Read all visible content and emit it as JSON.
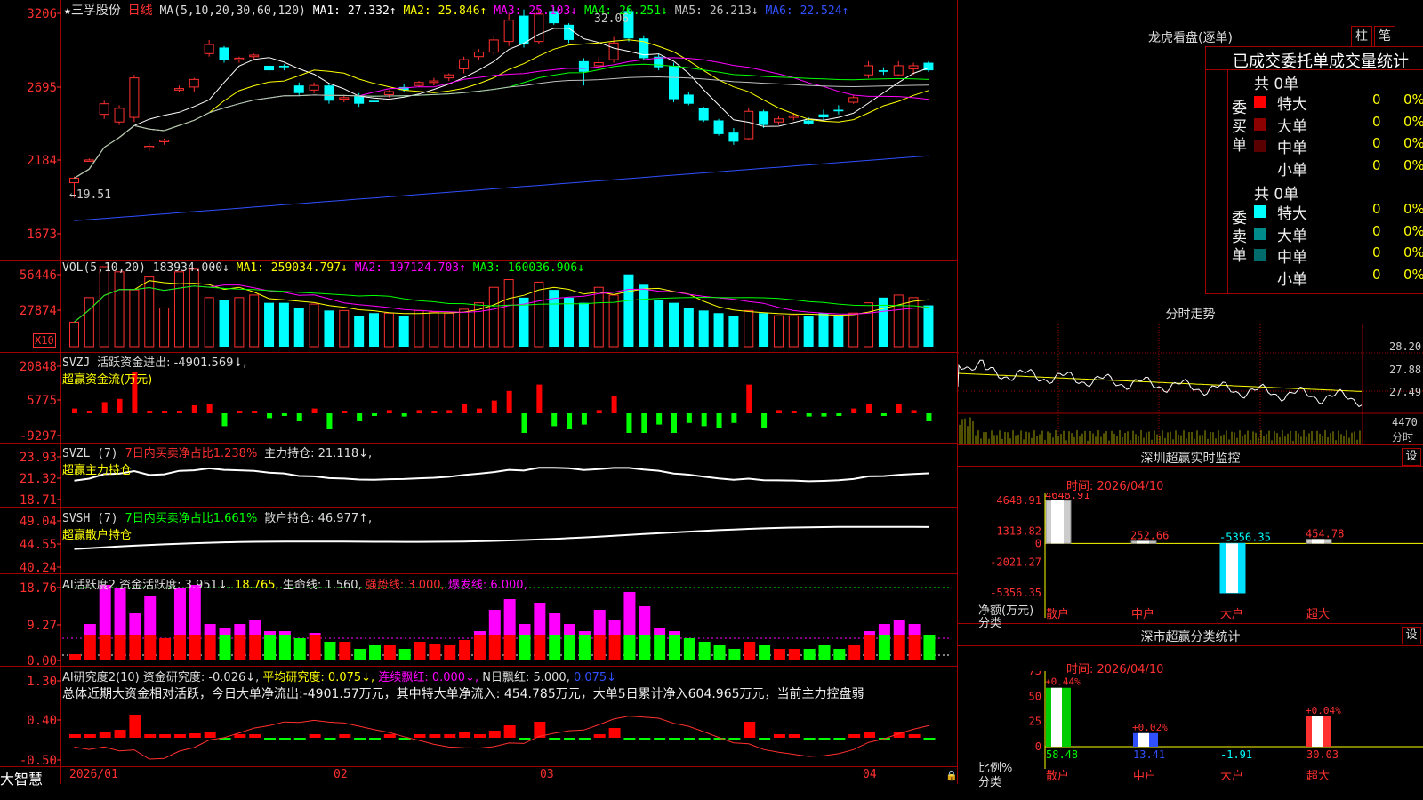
{
  "stock": {
    "name": "三孚股份",
    "period": "日线",
    "star": "★"
  },
  "ma_legend": {
    "label": "MA(5,10,20,30,60,120)",
    "items": [
      {
        "text": "MA1: 27.332↑",
        "color": "#ffffff"
      },
      {
        "text": "MA2: 25.846↑",
        "color": "#ffff00"
      },
      {
        "text": "MA3: 25.103↓",
        "color": "#ff00ff"
      },
      {
        "text": "MA4: 26.251↓",
        "color": "#00ff00"
      },
      {
        "text": "MA5: 26.213↓",
        "color": "#c0c0c0"
      },
      {
        "text": "MA6: 22.524↑",
        "color": "#3050ff"
      }
    ],
    "high_label": "32.06",
    "low_label": "←19.51"
  },
  "price_axis": [
    "3206",
    "2695",
    "2184",
    "1673"
  ],
  "vol": {
    "label": "VOL(5,10,20)",
    "value": "183934.000↓",
    "items": [
      {
        "text": "MA1: 259034.797↓",
        "color": "#ffff00"
      },
      {
        "text": "MA2: 197124.703↑",
        "color": "#ff00ff"
      },
      {
        "text": "MA3: 160036.906↓",
        "color": "#00ff00"
      }
    ],
    "axis": [
      "56446",
      "27874"
    ],
    "unit": "X10"
  },
  "svzj": {
    "label": "SVZJ",
    "line1": "活跃资金进出: -4901.569↓,",
    "line2": "超赢资金流(万元)",
    "axis": [
      "20848",
      "5775",
      "-9297"
    ]
  },
  "svzl": {
    "label": "SVZL (7)",
    "pct": "7日内买卖净占比1.238%",
    "hold": "主力持仓: 21.118↓,",
    "line2": "超赢主力持仓",
    "axis": [
      "23.93",
      "21.32",
      "18.71"
    ]
  },
  "svsh": {
    "label": "SVSH (7)",
    "pct": "7日内买卖净占比1.661%",
    "hold": "散户持仓: 46.977↑,",
    "line2": "超赢散户持仓",
    "axis": [
      "49.04",
      "44.55",
      "40.24"
    ]
  },
  "ai1": {
    "label": "AI活跃度2",
    "v1": "资金活跃度: 3.951↓,",
    "v2": "18.765,",
    "v3": "生命线: 1.560,",
    "v4": "强势线: 3.000,",
    "v5": "爆发线: 6.000,",
    "axis": [
      "18.76",
      "9.27",
      "0.00"
    ]
  },
  "ai2": {
    "label": "AI研究度2(10)",
    "v1": "资金研究度: -0.026↓,",
    "v2": "平均研究度: 0.075↓,",
    "v3": "连续飘红: 0.000↓,",
    "v4": "N日飘红: 5.000,",
    "v5": "0.075↓",
    "axis": [
      "1.30",
      "0.40",
      "-0.50"
    ],
    "summary": "总体近期大资金相对活跃，今日大单净流出:-4901.57万元，其中特大单净流入: 454.785万元，大单5日累计净入604.965万元，当前主力控盘弱"
  },
  "date_axis": [
    "2026/01",
    "02",
    "03",
    "04"
  ],
  "brand": "大智慧",
  "lhb": {
    "title": "龙虎看盘(逐单)",
    "btn1": "柱",
    "btn2": "笔",
    "subtitle": "已成交委托单成交量统计",
    "buy": {
      "side": "委买单",
      "total": "共 0单",
      "rows": [
        {
          "name": "特大",
          "n": "0",
          "p": "0%",
          "color": "#ff0000"
        },
        {
          "name": "大单",
          "n": "0",
          "p": "0%",
          "color": "#8b0000"
        },
        {
          "name": "中单",
          "n": "0",
          "p": "0%",
          "color": "#5a0000"
        },
        {
          "name": "小单",
          "n": "0",
          "p": "0%",
          "color": "#000000"
        }
      ]
    },
    "sell": {
      "side": "委卖单",
      "total": "共 0单",
      "rows": [
        {
          "name": "特大",
          "n": "0",
          "p": "0%",
          "color": "#00ffff"
        },
        {
          "name": "大单",
          "n": "0",
          "p": "0%",
          "color": "#008b8b"
        },
        {
          "name": "中单",
          "n": "0",
          "p": "0%",
          "color": "#006b6b"
        },
        {
          "name": "小单",
          "n": "0",
          "p": "0%",
          "color": "#000000"
        }
      ]
    }
  },
  "fenshi": {
    "title": "分时走势",
    "axis": [
      "28.20",
      "27.88",
      "27.49"
    ],
    "vol_label": "4470",
    "vol_unit": "分时"
  },
  "sz_monitor": {
    "title": "深圳超赢实时监控",
    "btn": "设",
    "date": "时间: 2026/04/10",
    "axis": [
      "4648.91",
      "1313.82",
      "0",
      "-2021.27",
      "-5356.35"
    ],
    "bars": [
      {
        "cat": "散户",
        "value": 4648.91,
        "label": "4648.91"
      },
      {
        "cat": "中户",
        "value": 252.66,
        "label": "252.66"
      },
      {
        "cat": "大户",
        "value": -5356.35,
        "label": "-5356.35"
      },
      {
        "cat": "超大",
        "value": 454.78,
        "label": "454.78"
      }
    ],
    "ylabel": "净额(万元)",
    "xlabel": "分类"
  },
  "sz_class": {
    "title": "深市超赢分类统计",
    "btn": "设",
    "date": "时间: 2026/04/10",
    "axis": [
      "75",
      "50",
      "25",
      "0"
    ],
    "bars": [
      {
        "cat": "散户",
        "value": 58.48,
        "top": "+0.44%",
        "bottom": "58.48"
      },
      {
        "cat": "中户",
        "value": 13.41,
        "top": "+0.02%",
        "bottom": "13.41"
      },
      {
        "cat": "大户",
        "value": -1.91,
        "top": "",
        "bottom": "-1.91"
      },
      {
        "cat": "超大",
        "value": 30.03,
        "top": "+0.04%",
        "bottom": "30.03"
      }
    ],
    "ylabel": "比例%",
    "xlabel": "分类"
  },
  "chart_data": {
    "type": "candlestick",
    "title": "三孚股份 日线",
    "ylim": [
      16.73,
      32.06
    ],
    "series": [
      {
        "name": "OHLC",
        "values": [
          [
            20.5,
            20.9,
            19.51,
            20.8
          ],
          [
            22.0,
            22.1,
            21.9,
            22.0
          ],
          [
            25.0,
            25.9,
            24.7,
            25.7
          ],
          [
            24.5,
            25.6,
            24.3,
            25.4
          ],
          [
            24.8,
            27.6,
            24.5,
            27.4
          ],
          [
            22.8,
            23.1,
            22.6,
            22.9
          ],
          [
            23.2,
            23.4,
            23.0,
            23.3
          ],
          [
            26.6,
            26.9,
            26.5,
            26.7
          ],
          [
            26.8,
            27.4,
            26.5,
            27.3
          ],
          [
            29.0,
            29.9,
            28.8,
            29.6
          ],
          [
            29.4,
            29.5,
            28.4,
            28.6
          ],
          [
            28.6,
            28.8,
            28.4,
            28.7
          ],
          [
            28.8,
            29.0,
            28.6,
            28.9
          ],
          [
            28.2,
            28.5,
            27.6,
            27.9
          ],
          [
            28.2,
            28.3,
            27.9,
            28.1
          ],
          [
            26.9,
            27.1,
            26.2,
            26.4
          ],
          [
            26.6,
            27.1,
            26.4,
            26.9
          ],
          [
            26.9,
            27.0,
            25.7,
            25.9
          ],
          [
            26.0,
            26.3,
            25.8,
            26.1
          ],
          [
            26.2,
            26.4,
            25.5,
            25.7
          ],
          [
            25.9,
            26.3,
            25.6,
            25.8
          ],
          [
            26.3,
            26.6,
            26.1,
            26.5
          ],
          [
            26.8,
            27.0,
            26.5,
            26.6
          ],
          [
            26.9,
            27.2,
            26.8,
            27.1
          ],
          [
            27.1,
            27.4,
            26.9,
            27.2
          ],
          [
            27.4,
            27.7,
            27.2,
            27.6
          ],
          [
            28.0,
            28.8,
            27.7,
            28.6
          ],
          [
            28.8,
            29.3,
            28.6,
            29.1
          ],
          [
            29.1,
            30.2,
            28.9,
            29.9
          ],
          [
            29.8,
            31.6,
            29.5,
            31.2
          ],
          [
            31.5,
            31.9,
            29.4,
            29.6
          ],
          [
            29.8,
            31.9,
            29.6,
            31.6
          ],
          [
            31.8,
            32.06,
            30.9,
            31.0
          ],
          [
            30.9,
            31.0,
            29.7,
            29.9
          ],
          [
            28.5,
            28.7,
            26.9,
            27.8
          ],
          [
            28.2,
            28.8,
            27.9,
            28.4
          ],
          [
            28.6,
            30.1,
            28.4,
            29.7
          ],
          [
            31.8,
            32.0,
            29.8,
            30.0
          ],
          [
            30.0,
            30.2,
            28.6,
            28.7
          ],
          [
            28.8,
            29.0,
            27.9,
            28.1
          ],
          [
            28.2,
            28.4,
            25.8,
            26.0
          ],
          [
            26.3,
            26.5,
            25.6,
            25.7
          ],
          [
            25.4,
            25.5,
            24.5,
            24.6
          ],
          [
            24.6,
            24.7,
            23.6,
            23.7
          ],
          [
            23.8,
            24.1,
            23.0,
            23.2
          ],
          [
            23.4,
            25.4,
            23.3,
            25.2
          ],
          [
            25.2,
            25.3,
            24.1,
            24.3
          ],
          [
            24.5,
            24.9,
            24.3,
            24.7
          ],
          [
            24.8,
            25.1,
            24.6,
            24.9
          ],
          [
            24.6,
            24.8,
            24.3,
            24.4
          ],
          [
            25.0,
            25.3,
            24.6,
            24.8
          ],
          [
            25.3,
            25.6,
            25.0,
            25.2
          ],
          [
            25.8,
            26.3,
            25.7,
            26.1
          ],
          [
            27.6,
            28.5,
            27.4,
            28.2
          ],
          [
            27.9,
            28.1,
            27.6,
            27.8
          ],
          [
            27.6,
            28.5,
            27.5,
            28.2
          ],
          [
            28.0,
            28.4,
            27.6,
            28.2
          ],
          [
            28.4,
            28.5,
            27.8,
            27.9
          ]
        ]
      }
    ],
    "volume": [
      19,
      38,
      62,
      58,
      44,
      54,
      30,
      58,
      60,
      38,
      36,
      38,
      40,
      34,
      34,
      30,
      33,
      28,
      28,
      24,
      26,
      26,
      24,
      28,
      27,
      26,
      29,
      34,
      46,
      52,
      38,
      50,
      44,
      38,
      34,
      46,
      40,
      56,
      48,
      36,
      34,
      30,
      28,
      26,
      24,
      28,
      26,
      24,
      24,
      24,
      26,
      24,
      26,
      34,
      38,
      40,
      38,
      32
    ]
  }
}
